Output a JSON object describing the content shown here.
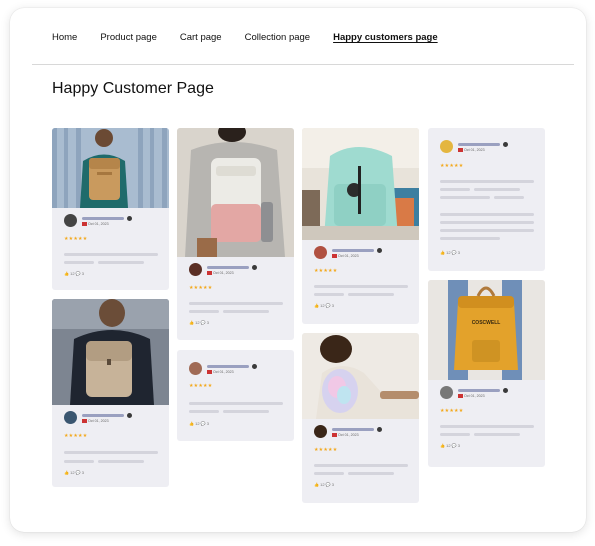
{
  "nav": {
    "items": [
      {
        "label": "Home",
        "active": false
      },
      {
        "label": "Product page",
        "active": false
      },
      {
        "label": "Cart page",
        "active": false
      },
      {
        "label": "Collection page",
        "active": false
      },
      {
        "label": "Happy customers page",
        "active": true
      }
    ]
  },
  "page": {
    "title": "Happy Customer Page"
  },
  "reviews": [
    {
      "date": "Oct 01, 2023",
      "rating": "★★★★★",
      "likes": "12",
      "comments": "3",
      "photo": "backpack-tan-rolltop"
    },
    {
      "date": "Oct 01, 2023",
      "rating": "★★★★★",
      "likes": "12",
      "comments": "3",
      "photo": "backpack-beige-flap"
    },
    {
      "date": "Oct 01, 2023",
      "rating": "★★★★★",
      "likes": "12",
      "comments": "3",
      "photo": "backpack-pink-white"
    },
    {
      "date": "Oct 01, 2023",
      "rating": "★★★★★",
      "likes": "12",
      "comments": "3",
      "photo": ""
    },
    {
      "date": "Oct 01, 2023",
      "rating": "★★★★★",
      "likes": "12",
      "comments": "3",
      "photo": "backpack-mint"
    },
    {
      "date": "Oct 01, 2023",
      "rating": "★★★★★",
      "likes": "12",
      "comments": "3",
      "photo": "backpack-holographic"
    },
    {
      "date": "Oct 01, 2023",
      "rating": "★★★★★",
      "likes": "12",
      "comments": "3",
      "photo": ""
    },
    {
      "date": "Oct 01, 2023",
      "rating": "★★★★★",
      "likes": "12",
      "comments": "3",
      "photo": "backpack-mustard-rolltop"
    }
  ],
  "brand_text": "COSCWELL",
  "colors": {
    "card_bg": "#eeeef3",
    "star": "#f3a81b",
    "name_bar": "#9aa0c0",
    "text_bar": "#d4d4dc"
  }
}
